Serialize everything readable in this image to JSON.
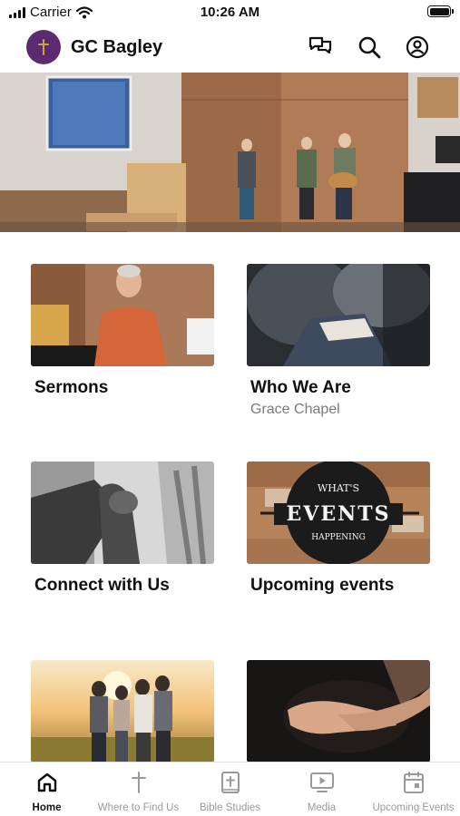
{
  "status_bar": {
    "carrier": "Carrier",
    "time": "10:26 AM"
  },
  "header": {
    "title": "GC Bagley",
    "icons": [
      "chat-icon",
      "search-icon",
      "account-icon"
    ]
  },
  "hero": {
    "image": "worship-band-photo"
  },
  "cards": [
    {
      "title": "Sermons",
      "subtitle": "",
      "image": "preacher-photo"
    },
    {
      "title": "Who We Are",
      "subtitle": "Grace Chapel",
      "image": "congregation-bible-photo"
    },
    {
      "title": "Connect with Us",
      "subtitle": "",
      "image": "holding-hands-photo"
    },
    {
      "title": "Upcoming events",
      "subtitle": "",
      "image": "whats-happening-events-sign"
    },
    {
      "title": "",
      "subtitle": "",
      "image": "friends-sunset-photo"
    },
    {
      "title": "",
      "subtitle": "",
      "image": "open-hands-photo"
    }
  ],
  "events_sign": {
    "top": "WHAT'S",
    "middle": "EVENTS",
    "bottom": "HAPPENING"
  },
  "tab_bar": {
    "items": [
      {
        "label": "Home",
        "icon": "home-icon",
        "active": true
      },
      {
        "label": "Where to Find Us",
        "icon": "cross-icon",
        "active": false
      },
      {
        "label": "Bible Studies",
        "icon": "bible-icon",
        "active": false
      },
      {
        "label": "Media",
        "icon": "play-screen-icon",
        "active": false
      },
      {
        "label": "Upcoming Events",
        "icon": "calendar-icon",
        "active": false
      }
    ]
  },
  "colors": {
    "avatar": "#5c2a6e",
    "active_tab": "#111111",
    "inactive_tab": "#9a9a9a",
    "subtitle": "#7a7a7a"
  }
}
